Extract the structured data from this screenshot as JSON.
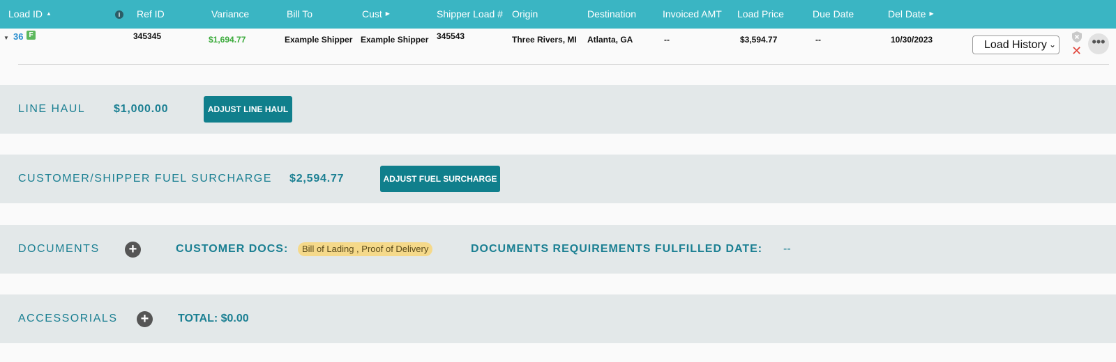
{
  "header": {
    "load_id": "Load ID",
    "ref_id": "Ref ID",
    "variance": "Variance",
    "bill_to": "Bill To",
    "cust": "Cust",
    "shipper_load": "Shipper Load #",
    "origin": "Origin",
    "destination": "Destination",
    "invoiced_amt": "Invoiced AMT",
    "load_price": "Load Price",
    "due_date": "Due Date",
    "del_date": "Del Date"
  },
  "row": {
    "load_id": "36",
    "flag": "F",
    "ref_id": "345345",
    "variance": "$1,694.77",
    "bill_to": "Example Shipper",
    "cust": "Example Shipper",
    "shipper_load": "345543",
    "origin": "Three Rivers, MI",
    "destination": "Atlanta, GA",
    "invoiced_amt": "--",
    "load_price": "$3,594.77",
    "due_date": "--",
    "del_date": "10/30/2023",
    "history_select": "Load History",
    "more": "•••"
  },
  "line_haul": {
    "title": "LINE HAUL",
    "amount": "$1,000.00",
    "button": "ADJUST LINE HAUL"
  },
  "fuel": {
    "title": "CUSTOMER/SHIPPER FUEL SURCHARGE",
    "amount": "$2,594.77",
    "button": "ADJUST FUEL SURCHARGE"
  },
  "documents": {
    "title": "DOCUMENTS",
    "customer_docs_label": "CUSTOMER DOCS:",
    "customer_docs": "Bill of Lading , Proof of Delivery",
    "fulfilled_label": "DOCUMENTS REQUIREMENTS FULFILLED DATE:",
    "fulfilled_value": "--"
  },
  "accessorials": {
    "title": "ACCESSORIALS",
    "total": "TOTAL: $0.00"
  },
  "colors": {
    "header_bg": "#3ab5c3",
    "accent": "#1a7f92",
    "button_bg": "#107f8c",
    "variance_green": "#3aaa3a",
    "badge_bg": "#f5d98a"
  }
}
